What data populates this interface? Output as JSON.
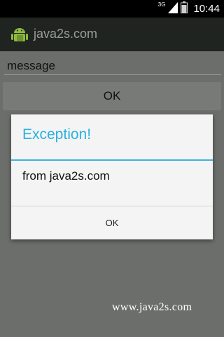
{
  "status_bar": {
    "network_type": "3G",
    "time": "10:44",
    "icons": [
      "signal-icon",
      "battery-icon"
    ]
  },
  "action_bar": {
    "title": "java2s.com",
    "icon": "android-app-icon"
  },
  "main": {
    "message_input": {
      "value": "message"
    },
    "ok_button": "OK"
  },
  "dialog": {
    "title": "Exception!",
    "message": "from java2s.com",
    "ok_button": "OK"
  },
  "watermark": "www.java2s.com",
  "colors": {
    "accent": "#2ab2e0",
    "background": "#6c6e6c",
    "action_bar": "#202420"
  }
}
